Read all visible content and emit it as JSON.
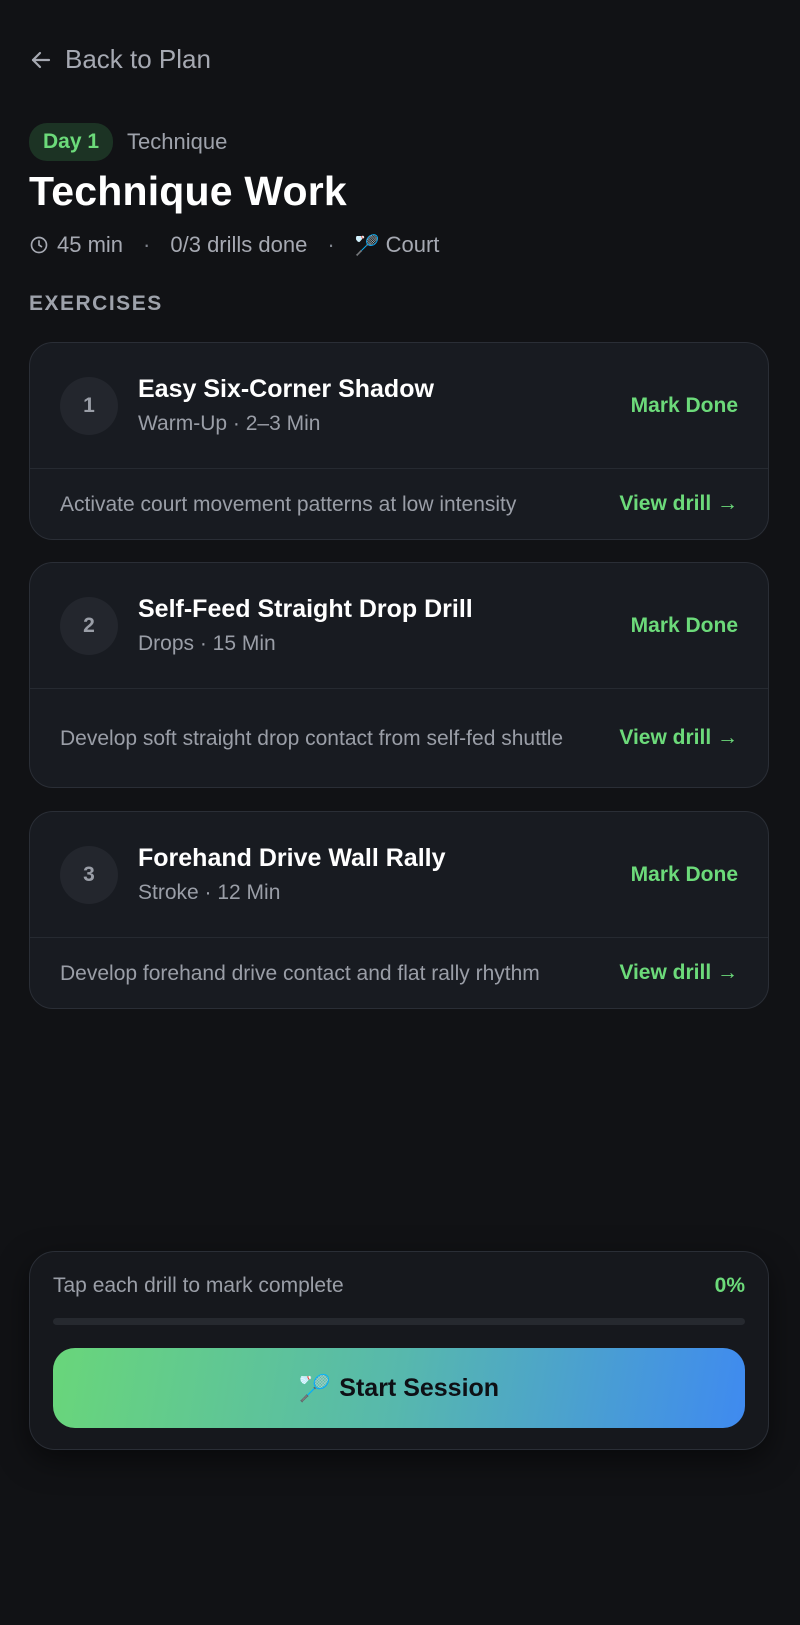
{
  "nav": {
    "back_label": "Back to Plan"
  },
  "header": {
    "day_badge": "Day 1",
    "category": "Technique",
    "title": "Technique Work",
    "duration": "45 min",
    "drills_done": "0/3 drills done",
    "location": "Court"
  },
  "section_label": "EXERCISES",
  "exercises": [
    {
      "number": "1",
      "title": "Easy Six-Corner Shadow",
      "subtitle": "Warm-Up · 2–3 Min",
      "description": "Activate court movement patterns at low intensity",
      "mark_done": "Mark Done",
      "view_drill": "View drill →"
    },
    {
      "number": "2",
      "title": "Self-Feed Straight Drop Drill",
      "subtitle": "Drops · 15 Min",
      "description": "Develop soft straight drop contact from self-fed shuttle",
      "mark_done": "Mark Done",
      "view_drill": "View drill →"
    },
    {
      "number": "3",
      "title": "Forehand Drive Wall Rally",
      "subtitle": "Stroke · 12 Min",
      "description": "Develop forehand drive contact and flat rally rhythm",
      "mark_done": "Mark Done",
      "view_drill": "View drill →"
    }
  ],
  "footer": {
    "hint": "Tap each drill to mark complete",
    "progress_label": "0%",
    "progress_fraction": 0,
    "start_label": "Start Session"
  },
  "icons": {
    "back": "arrow-left-icon",
    "clock": "clock-icon",
    "racket": "badminton-racket-icon"
  },
  "colors": {
    "background": "#111215",
    "card": "#181b21",
    "accent_green": "#6cda7a",
    "gradient_start": "#69d67a",
    "gradient_end": "#3f8af0"
  }
}
